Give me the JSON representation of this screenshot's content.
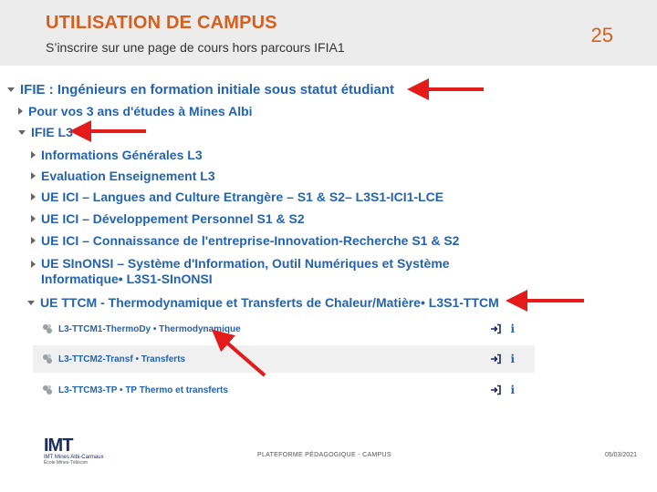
{
  "slide": {
    "title": "UTILISATION DE CAMPUS",
    "subtitle": "S’inscrire sur une page de cours hors parcours IFIA1",
    "page_number": "25",
    "footer_center": "PLATEFORME PÉDAGOGIQUE - CAMPUS",
    "footer_date": "05/03/2021",
    "logo": {
      "main": "IMT",
      "line1": "IMT Mines Albi-Carmaux",
      "line2": "École Mines-Télécom"
    }
  },
  "tree": {
    "root": "IFIE : Ingénieurs en formation initiale sous statut étudiant",
    "item1": "Pour vos 3 ans d'études à Mines Albi",
    "l3": "IFIE L3",
    "c1": "Informations Générales L3",
    "c2": "Evaluation Enseignement L3",
    "c3": "UE ICI – Langues and Culture Etrangère – S1 & S2– L3S1-ICI1-LCE",
    "c4": "UE ICI – Développement Personnel S1 & S2",
    "c5": "UE ICI – Connaissance de l'entreprise-Innovation-Recherche S1 & S2",
    "c6": "UE SInONSI – Système d'Information, Outil Numériques et Système Informatique• L3S1-SInONSI",
    "c7": "UE TTCM - Thermodynamique et Transferts de Chaleur/Matière• L3S1-TTCM"
  },
  "activities": [
    {
      "label": "L3-TTCM1-ThermoDy • Thermodynamique",
      "info": "i"
    },
    {
      "label": "L3-TTCM2-Transf • Transferts",
      "info": "i"
    },
    {
      "label": "L3-TTCM3-TP • TP Thermo et transferts",
      "info": "i"
    }
  ],
  "colors": {
    "accent": "#d75f1e",
    "link": "#2563b0",
    "arrow": "#e31b1b"
  }
}
